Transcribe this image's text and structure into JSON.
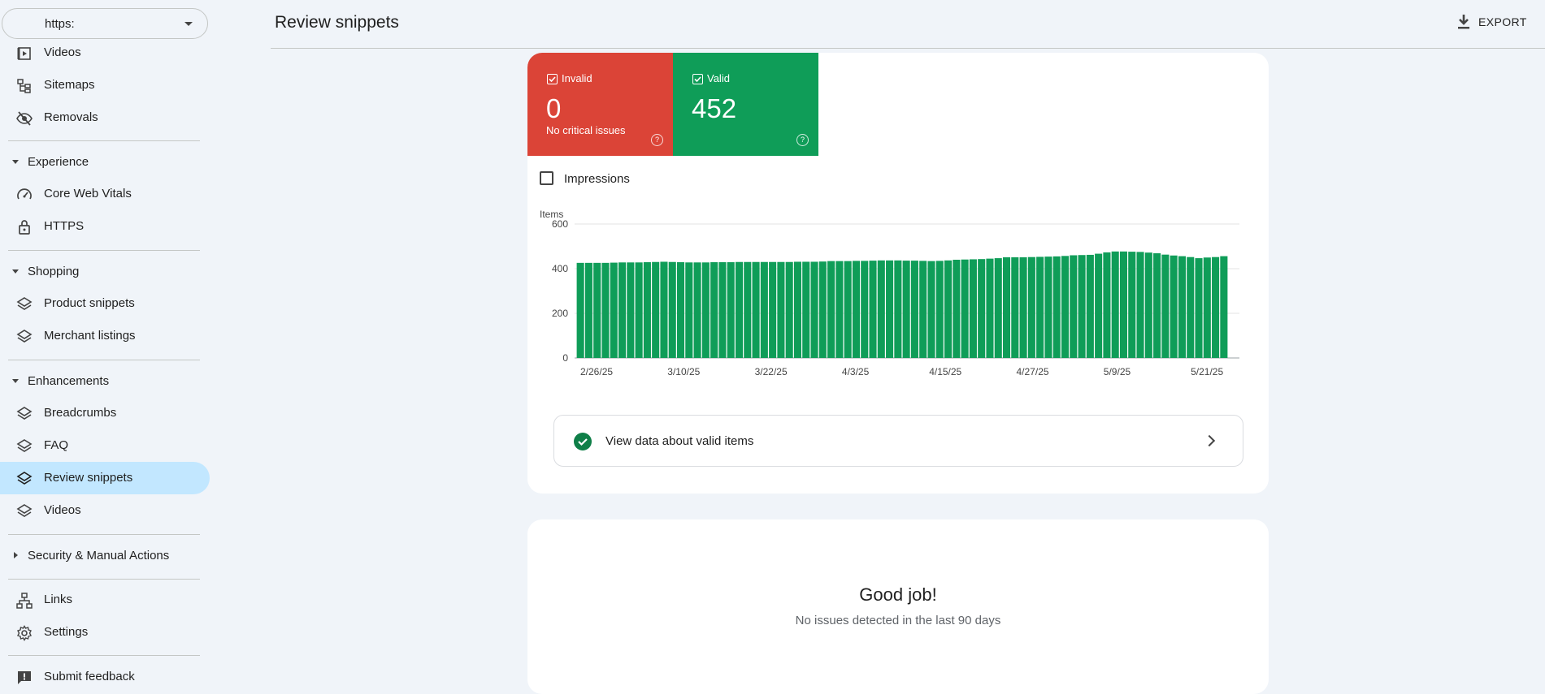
{
  "property": {
    "value": "https:"
  },
  "nav": {
    "items_top": [
      {
        "label": "Videos",
        "icon": "video-icon"
      },
      {
        "label": "Sitemaps",
        "icon": "sitemap-icon"
      },
      {
        "label": "Removals",
        "icon": "eye-off-icon"
      }
    ],
    "experience": {
      "label": "Experience",
      "items": [
        {
          "label": "Core Web Vitals",
          "icon": "speed-icon"
        },
        {
          "label": "HTTPS",
          "icon": "lock-icon"
        }
      ]
    },
    "shopping": {
      "label": "Shopping",
      "items": [
        {
          "label": "Product snippets",
          "icon": "layers-icon"
        },
        {
          "label": "Merchant listings",
          "icon": "layers-icon"
        }
      ]
    },
    "enhancements": {
      "label": "Enhancements",
      "items": [
        {
          "label": "Breadcrumbs",
          "icon": "layers-icon"
        },
        {
          "label": "FAQ",
          "icon": "layers-icon"
        },
        {
          "label": "Review snippets",
          "icon": "layers-icon"
        },
        {
          "label": "Videos",
          "icon": "layers-icon"
        }
      ]
    },
    "security": {
      "label": "Security & Manual Actions"
    },
    "bottom": [
      {
        "label": "Links",
        "icon": "links-icon"
      },
      {
        "label": "Settings",
        "icon": "gear-icon"
      },
      {
        "label": "Submit feedback",
        "icon": "feedback-icon"
      }
    ]
  },
  "header": {
    "title": "Review snippets",
    "export_label": "EXPORT"
  },
  "tiles": {
    "invalid": {
      "label": "Invalid",
      "value": "0",
      "sub": "No critical issues",
      "color": "#db4437"
    },
    "valid": {
      "label": "Valid",
      "value": "452",
      "color": "#0f9d58"
    }
  },
  "impressions_label": "Impressions",
  "chart_data": {
    "type": "bar",
    "ylabel": "Items",
    "ylim": [
      0,
      600
    ],
    "yticks": [
      0,
      200,
      400,
      600
    ],
    "xtick_labels": [
      "2/26/25",
      "3/10/25",
      "3/22/25",
      "4/3/25",
      "4/15/25",
      "4/27/25",
      "5/9/25",
      "5/21/25"
    ],
    "bar_color": "#0f9d58",
    "values": [
      426,
      426,
      426,
      426,
      427,
      428,
      428,
      428,
      429,
      430,
      431,
      430,
      429,
      428,
      428,
      428,
      429,
      429,
      429,
      430,
      430,
      430,
      430,
      430,
      430,
      430,
      431,
      431,
      431,
      432,
      434,
      434,
      434,
      435,
      435,
      436,
      437,
      437,
      437,
      436,
      436,
      435,
      434,
      435,
      437,
      440,
      441,
      442,
      443,
      445,
      447,
      451,
      451,
      451,
      452,
      453,
      454,
      455,
      457,
      460,
      461,
      462,
      467,
      473,
      477,
      477,
      476,
      475,
      472,
      469,
      463,
      459,
      456,
      452,
      447,
      450,
      452,
      456
    ]
  },
  "valid_link": "View data about valid items",
  "good": {
    "title": "Good job!",
    "sub": "No issues detected in the last 90 days"
  }
}
